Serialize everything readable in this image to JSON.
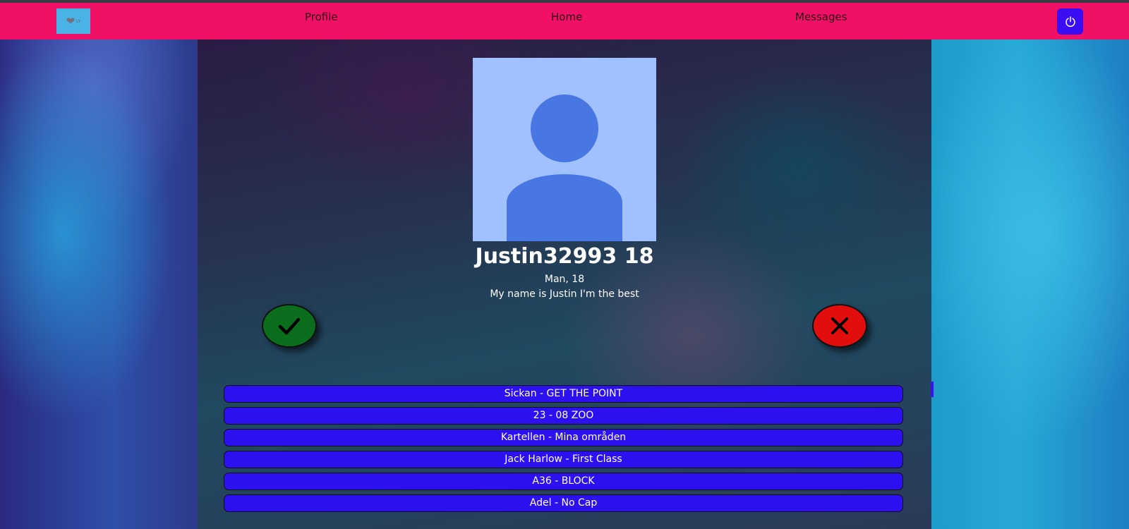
{
  "nav": {
    "logo_icon": "heart-logo",
    "logo_text": "LY",
    "links": [
      "Profile",
      "Home",
      "Messages"
    ],
    "power_icon": "power-icon"
  },
  "profile": {
    "avatar": "default-avatar-icon",
    "name": "Justin32993 18",
    "gender_age": "Man, 18",
    "bio": "My name is Justin I'm the best"
  },
  "actions": {
    "like_icon": "checkmark-icon",
    "dislike_icon": "x-icon",
    "like_color": "#0a6e1c",
    "dislike_color": "#e20d0d"
  },
  "songs": [
    "Sickan - GET THE POINT",
    "23 - 08 ZOO",
    "Kartellen - Mina områden",
    "Jack Harlow - First Class",
    "A36 - BLOCK",
    "Adel - No Cap"
  ],
  "colors": {
    "navbar": "#f01066",
    "accent": "#2d10ef"
  }
}
